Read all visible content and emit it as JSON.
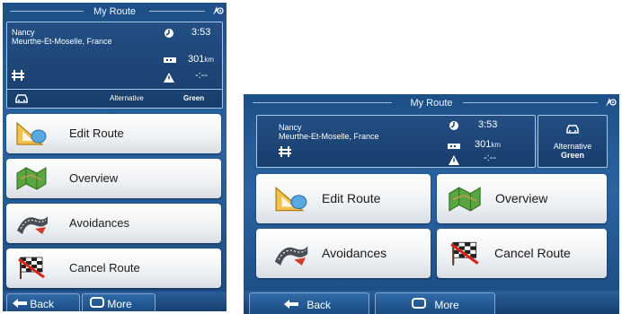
{
  "screen_title": "My Route",
  "route": {
    "destination_city": "Nancy",
    "destination_region": "Meurthe-Et-Moselle, France",
    "time": "3:53",
    "distance_value": "301",
    "distance_unit": "km",
    "delay": "-:--",
    "method_label": "Alternative",
    "method_value": "Green"
  },
  "buttons": {
    "edit_route": "Edit Route",
    "overview": "Overview",
    "avoidances": "Avoidances",
    "cancel_route": "Cancel Route"
  },
  "bottom": {
    "back": "Back",
    "more": "More"
  },
  "colors": {
    "background": "#1d4f86",
    "panel": "#183d6b",
    "button": "#eef1f4",
    "text_light": "#ffffff"
  },
  "icons": [
    "gps-icon",
    "clock-icon",
    "distance-icon",
    "highway-icon",
    "warning-icon",
    "car-icon",
    "ruler-triangle-icon",
    "map-icon",
    "road-icon",
    "checkered-flag-icon",
    "back-arrow-icon",
    "more-icon"
  ]
}
